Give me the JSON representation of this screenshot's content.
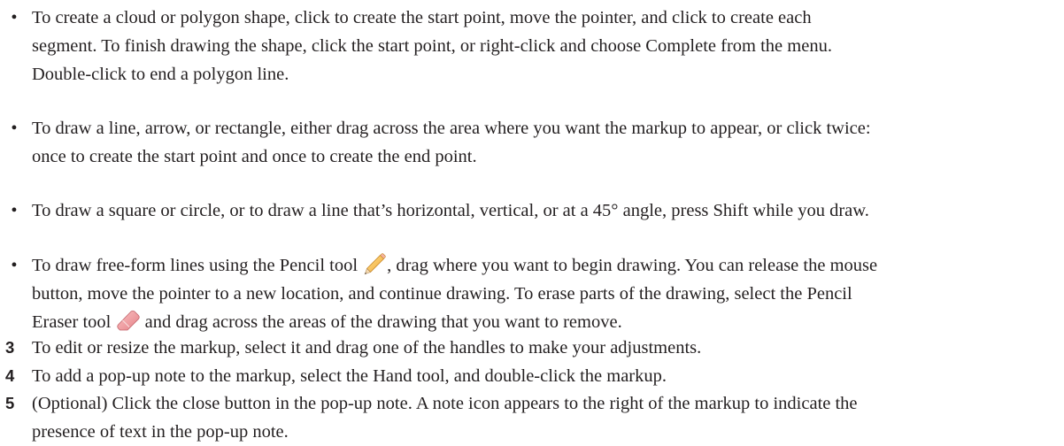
{
  "bullets": [
    {
      "marker": "•",
      "lines": [
        "To create a cloud or polygon shape, click to create the start point, move the pointer, and click to create each",
        "segment. To finish drawing the shape, click the start point, or right-click and choose Complete from the menu.",
        "Double-click to end a polygon line."
      ]
    },
    {
      "marker": "•",
      "lines": [
        "To draw a line, arrow, or rectangle, either drag across the area where you want the markup to appear, or click twice:",
        "once to create the start point and once to create the end point."
      ]
    },
    {
      "marker": "•",
      "lines": [
        "To draw a square or circle, or to draw a line that’s horizontal, vertical, or at a 45° angle, press Shift while you draw."
      ]
    },
    {
      "marker": "•",
      "line1_before_icon": "To draw free-form lines using the Pencil tool",
      "line1_after_icon": ", drag where you want to begin drawing. You can release the mouse",
      "line2": "button, move the pointer to a new location, and continue drawing. To erase parts of the drawing, select the Pencil",
      "line3_before_icon": "Eraser tool",
      "line3_after_icon": " and drag across the areas of the drawing that you want to remove."
    }
  ],
  "steps": [
    {
      "number": "3",
      "lines": [
        "To edit or resize the markup, select it and drag one of the handles to make your adjustments."
      ]
    },
    {
      "number": "4",
      "lines": [
        "To add a pop-up note to the markup, select the Hand tool, and double-click the markup."
      ]
    },
    {
      "number": "5",
      "lines": [
        "(Optional) Click the close button in the pop-up note. A note icon appears to the right of the markup to indicate the",
        "presence of text in the pop-up note."
      ]
    }
  ],
  "icons": {
    "pencil": "pencil-icon",
    "eraser": "pencil-eraser-icon"
  }
}
